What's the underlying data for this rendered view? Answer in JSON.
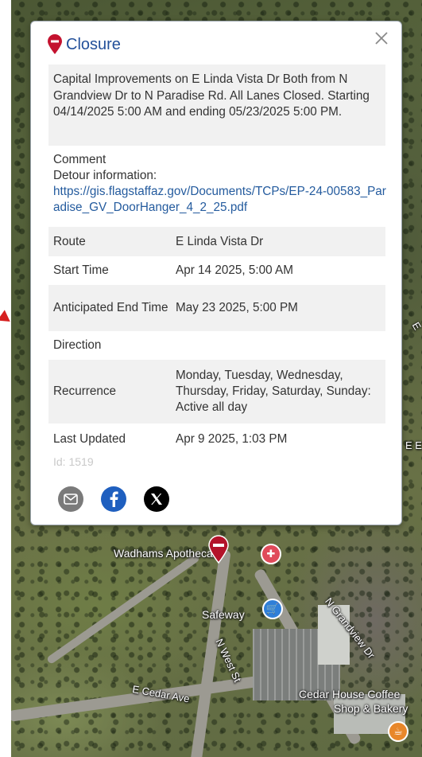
{
  "popup": {
    "title": "Closure",
    "description": "Capital Improvements on E Linda Vista Dr Both from N Grandview Dr to N Paradise Rd. All Lanes Closed. Starting 04/14/2025 5:00 AM and ending 05/23/2025 5:00 PM.",
    "comment_label": "Comment",
    "comment_text": "Detour information:",
    "comment_link": "https://gis.flagstaffaz.gov/Documents/TCPs/EP-24-00583_Paradise_GV_DoorHanger_4_2_25.pdf",
    "details": [
      {
        "label": "Route",
        "value": "E Linda Vista Dr"
      },
      {
        "label": "Start Time",
        "value": "Apr 14 2025, 5:00 AM"
      },
      {
        "label": "Anticipated End Time",
        "value": "May 23 2025, 5:00 PM"
      },
      {
        "label": "Direction",
        "value": ""
      },
      {
        "label": "Recurrence",
        "value": "Monday, Tuesday, Wednesday, Thursday, Friday, Saturday, Sunday: Active all day"
      },
      {
        "label": "Last Updated",
        "value": "Apr 9 2025, 1:03 PM"
      }
    ],
    "id_text": "Id: 1519",
    "share_icons": [
      "email-icon",
      "facebook-icon",
      "x-icon"
    ]
  },
  "map": {
    "labels": {
      "wadhams": "Wadhams Apothecary",
      "safeway": "Safeway",
      "n_west_st": "N West St",
      "n_grandview_dr": "N Grandview Dr",
      "e_cedar_ave": "E Cedar Ave",
      "cedar_house_1": "Cedar House Coffee",
      "cedar_house_2": "Shop & Bakery",
      "edge_e": "E",
      "edge_ee": "E E"
    }
  },
  "colors": {
    "title_blue": "#23509a",
    "link_blue": "#245b9e",
    "closure_red": "#c4122f",
    "facebook_blue": "#1f5fbf"
  }
}
